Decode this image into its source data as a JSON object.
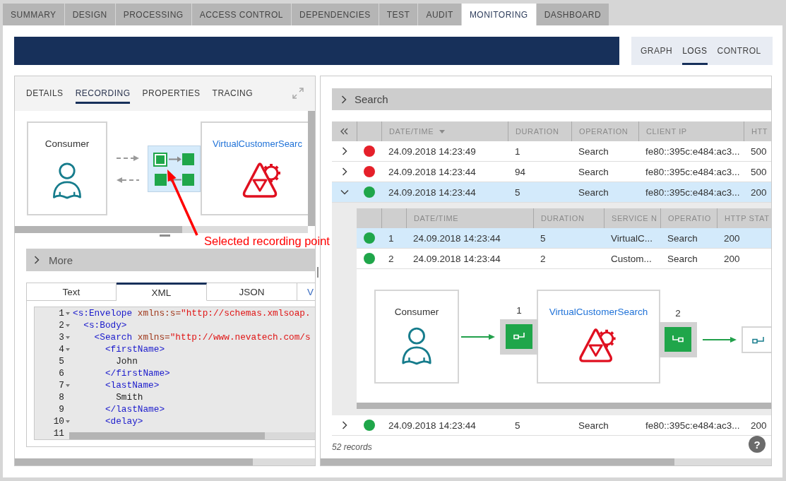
{
  "main_tabs": [
    {
      "label": "SUMMARY",
      "selected": false
    },
    {
      "label": "DESIGN",
      "selected": false
    },
    {
      "label": "PROCESSING",
      "selected": false
    },
    {
      "label": "ACCESS CONTROL",
      "selected": false
    },
    {
      "label": "DEPENDENCIES",
      "selected": false
    },
    {
      "label": "TEST",
      "selected": false
    },
    {
      "label": "AUDIT",
      "selected": false
    },
    {
      "label": "MONITORING",
      "selected": true
    },
    {
      "label": "DASHBOARD",
      "selected": false
    }
  ],
  "view_tabs": [
    {
      "label": "GRAPH",
      "selected": false
    },
    {
      "label": "LOGS",
      "selected": true
    },
    {
      "label": "CONTROL",
      "selected": false
    }
  ],
  "left_panel": {
    "tabs": [
      {
        "label": "DETAILS",
        "selected": false
      },
      {
        "label": "RECORDING",
        "selected": true
      },
      {
        "label": "PROPERTIES",
        "selected": false
      },
      {
        "label": "TRACING",
        "selected": false
      }
    ],
    "diagram": {
      "consumer": "Consumer",
      "service": "VirtualCustomerSearc",
      "recording_points": [
        {
          "selected": true
        },
        {
          "selected": false
        },
        {
          "selected": false
        },
        {
          "selected": false
        }
      ]
    },
    "more": {
      "label": "More",
      "expanded": false
    },
    "content_tabs": [
      {
        "label": "Text",
        "selected": false
      },
      {
        "label": "XML",
        "selected": true
      },
      {
        "label": "JSON",
        "selected": false
      },
      {
        "label": "V",
        "selected": false
      }
    ],
    "code_lines": [
      {
        "number": "1",
        "foldable": true,
        "tokens": [
          {
            "kind": "tag",
            "text": "<s:Envelope"
          },
          {
            "kind": "attr",
            "text": " xmlns:s="
          },
          {
            "kind": "value",
            "text": "\"http://schemas.xmlsoap."
          }
        ]
      },
      {
        "number": "2",
        "foldable": true,
        "tokens": [
          {
            "kind": "tag",
            "text": "  <s:Body>"
          }
        ]
      },
      {
        "number": "3",
        "foldable": true,
        "tokens": [
          {
            "kind": "tag",
            "text": "    <Search"
          },
          {
            "kind": "attr",
            "text": " xmlns="
          },
          {
            "kind": "value",
            "text": "\"http://www.nevatech.com/s"
          }
        ]
      },
      {
        "number": "4",
        "foldable": true,
        "tokens": [
          {
            "kind": "tag",
            "text": "      <firstName>"
          }
        ]
      },
      {
        "number": "5",
        "foldable": false,
        "tokens": [
          {
            "kind": "text",
            "text": "        John"
          }
        ]
      },
      {
        "number": "6",
        "foldable": false,
        "tokens": [
          {
            "kind": "tag",
            "text": "      </firstName>"
          }
        ]
      },
      {
        "number": "7",
        "foldable": true,
        "tokens": [
          {
            "kind": "tag",
            "text": "      <lastName>"
          }
        ]
      },
      {
        "number": "8",
        "foldable": false,
        "tokens": [
          {
            "kind": "text",
            "text": "        Smith"
          }
        ]
      },
      {
        "number": "9",
        "foldable": false,
        "tokens": [
          {
            "kind": "tag",
            "text": "      </lastName>"
          }
        ]
      },
      {
        "number": "10",
        "foldable": true,
        "tokens": [
          {
            "kind": "tag",
            "text": "      <delay>"
          }
        ]
      },
      {
        "number": "11",
        "foldable": false
      }
    ]
  },
  "annotation": {
    "text": "Selected recording point"
  },
  "right_panel": {
    "search": {
      "label": "Search",
      "expanded": false
    },
    "columns": [
      {
        "label": "DATE/TIME",
        "sorted": true
      },
      {
        "label": "DURATION",
        "sorted": false
      },
      {
        "label": "OPERATION",
        "sorted": false
      },
      {
        "label": "CLIENT IP",
        "sorted": false
      },
      {
        "label": "HTT",
        "sorted": false
      }
    ],
    "rows": [
      {
        "expanded": false,
        "selected": false,
        "color": "#e5202a",
        "cells": [
          "24.09.2018 14:23:49",
          "1",
          "Search",
          "fe80::395c:e484:ac3...",
          "500"
        ]
      },
      {
        "expanded": false,
        "selected": false,
        "color": "#e5202a",
        "cells": [
          "24.09.2018 14:23:44",
          "94",
          "Search",
          "fe80::395c:e484:ac3...",
          "500"
        ]
      },
      {
        "expanded": true,
        "selected": true,
        "color": "#1fa64a",
        "cells": [
          "24.09.2018 14:23:44",
          "5",
          "Search",
          "fe80::395c:e484:ac3...",
          "200"
        ],
        "details": {
          "columns": [
            "DATE/TIME",
            "DURATION",
            "SERVICE N",
            "OPERATIO",
            "HTTP STAT"
          ],
          "rows": [
            {
              "selected": true,
              "color": "#1fa64a",
              "number": "1",
              "cells": [
                "24.09.2018 14:23:44",
                "5",
                "VirtualC...",
                "Search",
                "200"
              ]
            },
            {
              "selected": false,
              "color": "#1fa64a",
              "number": "2",
              "cells": [
                "24.09.2018 14:23:44",
                "2",
                "Custom...",
                "Search",
                "200"
              ]
            }
          ],
          "flow": {
            "consumer": "Consumer",
            "service": "VirtualCustomerSearch",
            "points": [
              {
                "label": "1",
                "kind": "inbound"
              },
              {
                "label": "2",
                "kind": "outbound"
              }
            ]
          }
        }
      },
      {
        "expanded": false,
        "selected": false,
        "color": "#1fa64a",
        "cells": [
          "24.09.2018 14:23:44",
          "5",
          "Search",
          "fe80::395c:e484:ac3...",
          "200"
        ]
      }
    ],
    "record_count": "52 records",
    "help": "?"
  }
}
